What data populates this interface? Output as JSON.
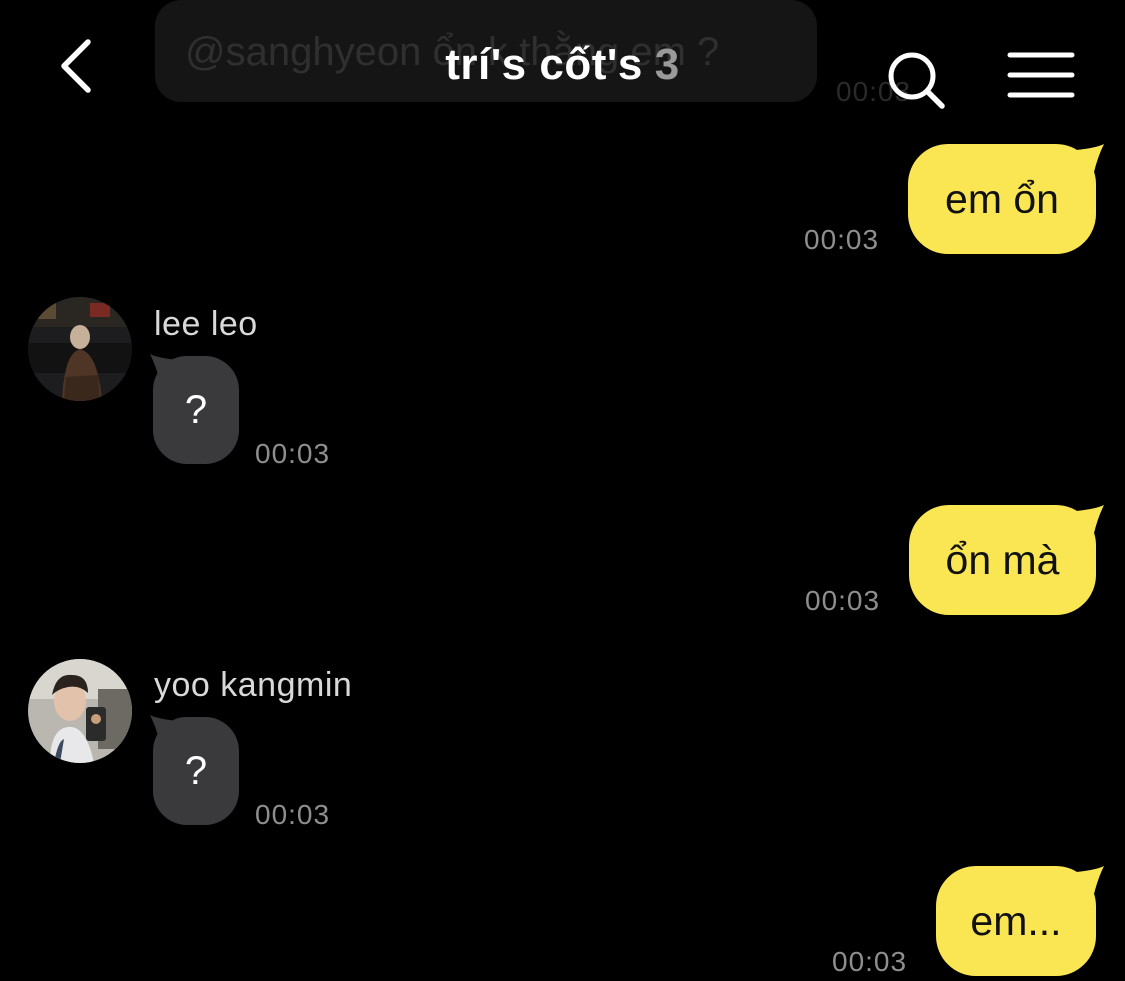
{
  "header": {
    "title": "trí's cốt's",
    "member_count": "3",
    "back_icon": "chevron-left-icon",
    "search_icon": "search-icon",
    "menu_icon": "hamburger-menu-icon"
  },
  "partial_message": {
    "text": "@sanghyeon ổn k thằng em ?",
    "time": "00:03"
  },
  "messages": [
    {
      "direction": "outgoing",
      "text": "em ổn",
      "time": "00:03"
    },
    {
      "direction": "incoming",
      "sender": "lee leo",
      "text": "?",
      "time": "00:03"
    },
    {
      "direction": "outgoing",
      "text": "ổn mà",
      "time": "00:03"
    },
    {
      "direction": "incoming",
      "sender": "yoo kangmin",
      "text": "?",
      "time": "00:03"
    },
    {
      "direction": "outgoing",
      "text": "em...",
      "time": "00:03"
    }
  ],
  "colors": {
    "background": "#000000",
    "outgoing_bubble": "#fae653",
    "incoming_bubble": "#3a3a3c",
    "timestamp": "#8e8e8e"
  }
}
